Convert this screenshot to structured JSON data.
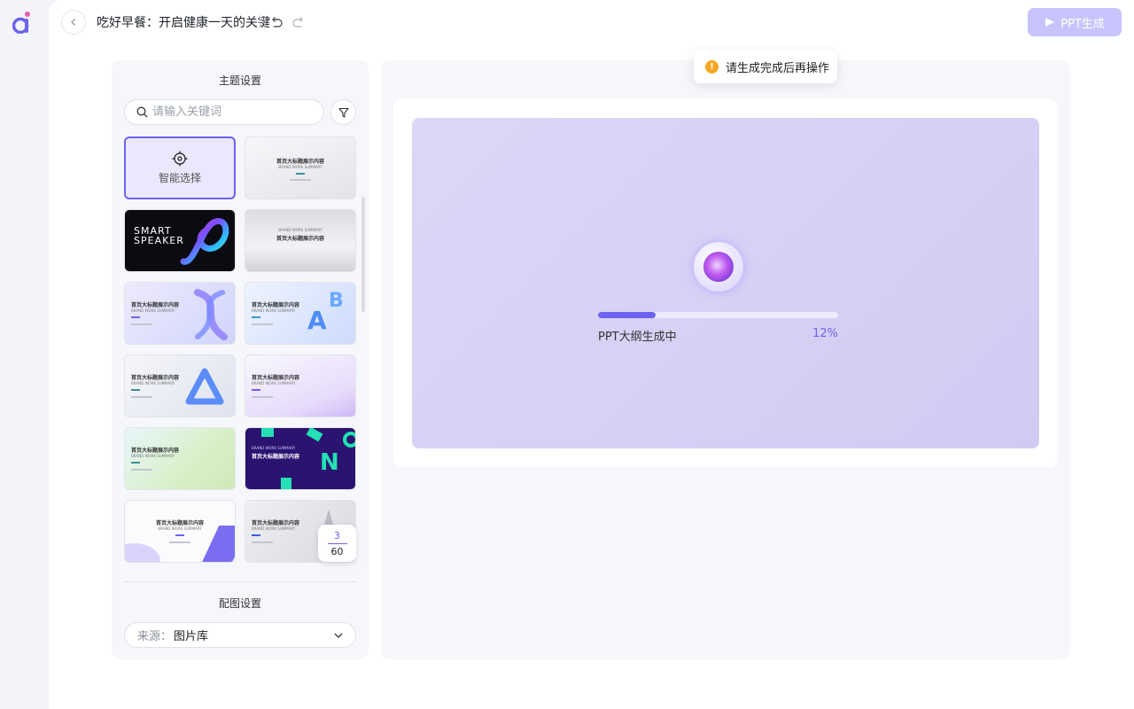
{
  "app": {
    "logo_icon": "app-logo-icon",
    "accent": "#6d63f0"
  },
  "header": {
    "title": "吃好早餐：开启健康一天的关键",
    "generate_label": "PPT生成"
  },
  "theme": {
    "section_title": "主题设置",
    "search_placeholder": "请输入关键词",
    "smart_select_label": "智能选择",
    "template_title": "首页大标题展示内容",
    "template_subtitle": "BRAND WORK SUMMARY",
    "smart_speaker_line1": "SMART",
    "smart_speaker_line2": "SPEAKER",
    "page_current": "3",
    "page_total": "60"
  },
  "image": {
    "section_title": "配图设置",
    "source_label": "来源：",
    "source_value": "图片库"
  },
  "progress": {
    "label": "PPT大纲生成中",
    "percent_text": "12%",
    "fraction": 0.12
  },
  "toast": {
    "message": "请生成完成后再操作"
  }
}
